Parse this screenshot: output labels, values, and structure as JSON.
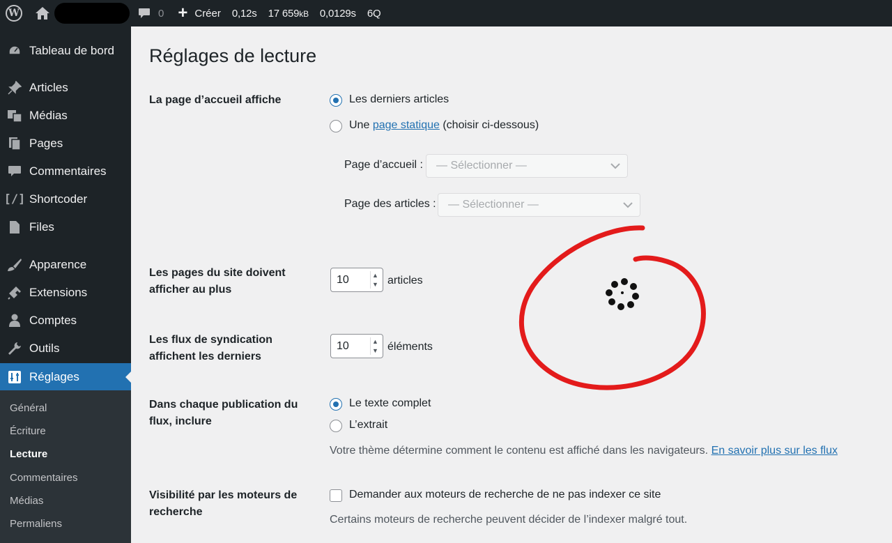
{
  "adminbar": {
    "comments_count": "0",
    "new_label": "Créer",
    "stat_time": "0,12s",
    "stat_mem_value": "17 659",
    "stat_mem_unit": "kB",
    "stat_query_time": "0,0129s",
    "stat_queries": "6Q"
  },
  "sidebar": {
    "items": [
      {
        "label": "Tableau de bord",
        "icon": "dashboard-icon"
      },
      {
        "label": "Articles",
        "icon": "pin-icon"
      },
      {
        "label": "Médias",
        "icon": "media-icon"
      },
      {
        "label": "Pages",
        "icon": "pages-icon"
      },
      {
        "label": "Commentaires",
        "icon": "comment-icon"
      },
      {
        "label": "Shortcoder",
        "icon": "shortcode-icon"
      },
      {
        "label": "Files",
        "icon": "file-icon"
      },
      {
        "label": "Apparence",
        "icon": "brush-icon"
      },
      {
        "label": "Extensions",
        "icon": "plugin-icon"
      },
      {
        "label": "Comptes",
        "icon": "user-icon"
      },
      {
        "label": "Outils",
        "icon": "wrench-icon"
      },
      {
        "label": "Réglages",
        "icon": "settings-icon"
      }
    ],
    "submenu": [
      "Général",
      "Écriture",
      "Lecture",
      "Commentaires",
      "Médias",
      "Permaliens"
    ]
  },
  "page": {
    "title": "Réglages de lecture",
    "front_page": {
      "label": "La page d’accueil affiche",
      "opt_latest": "Les derniers articles",
      "opt_static_prefix": "Une",
      "opt_static_link": "page statique",
      "opt_static_suffix": "(choisir ci-dessous)",
      "home_label": "Page d’accueil :",
      "posts_label": "Page des articles :",
      "select_placeholder": "— Sélectionner —"
    },
    "posts_per_page": {
      "label": "Les pages du site doivent afficher au plus",
      "value": "10",
      "unit": "articles"
    },
    "feed_items": {
      "label": "Les flux de syndication affichent les derniers",
      "value": "10",
      "unit": "éléments"
    },
    "feed_content": {
      "label": "Dans chaque publication du flux, inclure",
      "opt_full": "Le texte complet",
      "opt_excerpt": "L’extrait",
      "desc": "Votre thème détermine comment le contenu est affiché dans les navigateurs.",
      "desc_link": "En savoir plus sur les flux"
    },
    "visibility": {
      "label": "Visibilité par les moteurs de recherche",
      "checkbox_label": "Demander aux moteurs de recherche de ne pas indexer ce site",
      "desc": "Certains moteurs de recherche peuvent décider de l’indexer malgré tout."
    }
  },
  "colors": {
    "accent": "#2271b1",
    "annotation": "#e31b1b"
  }
}
